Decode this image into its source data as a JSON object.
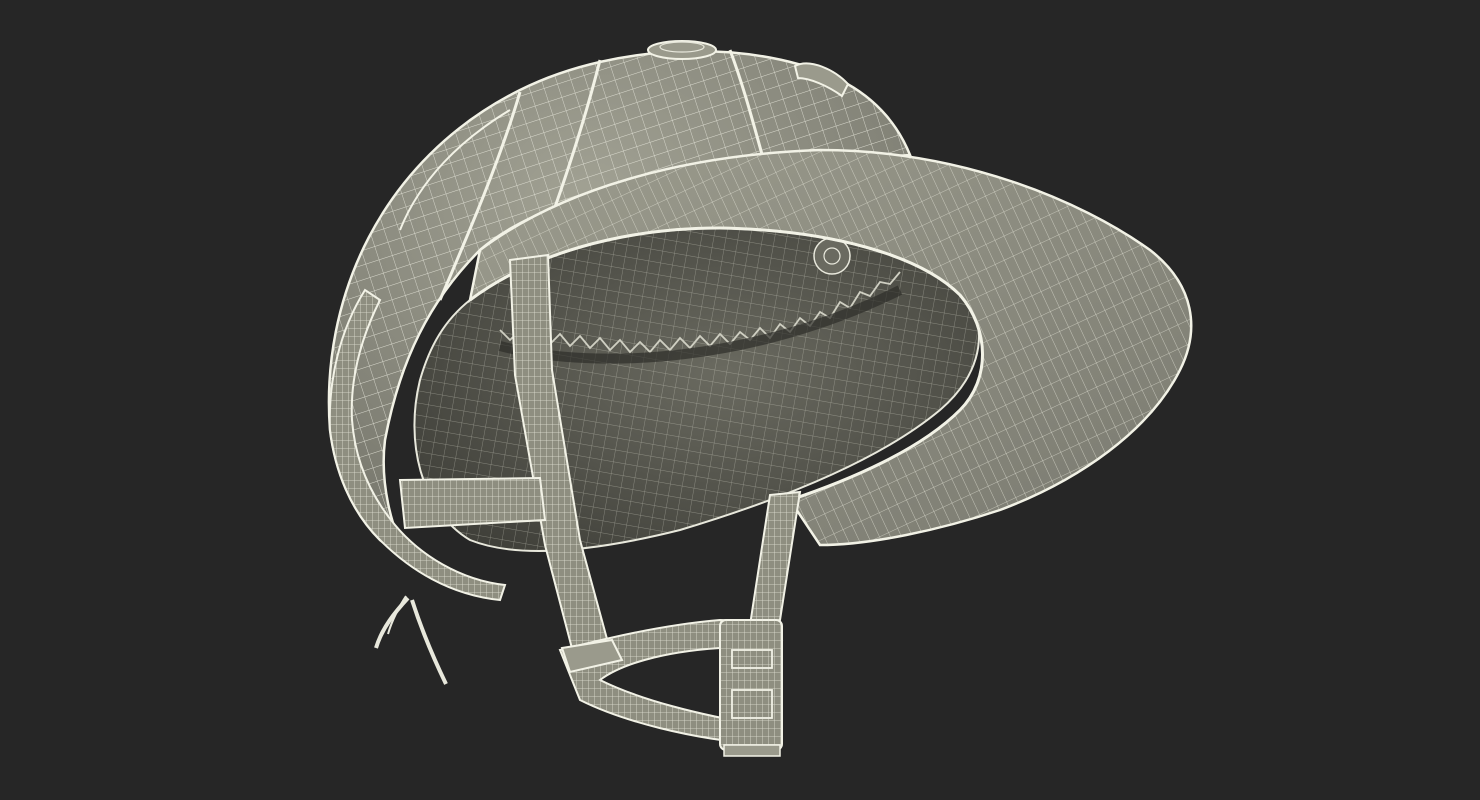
{
  "scene": {
    "background_color": "#262626",
    "subject": "polo-helmet-wireframe-model",
    "palette": {
      "shell_fill": "#8a8a7c",
      "shell_light": "#9a9a8c",
      "interior_fill": "#5f5f55",
      "interior_dark": "#3c3c36",
      "strap_fill": "#8e8e80",
      "wire_color": "#e8e8dc",
      "edge_color": "#f2f2e6"
    }
  }
}
